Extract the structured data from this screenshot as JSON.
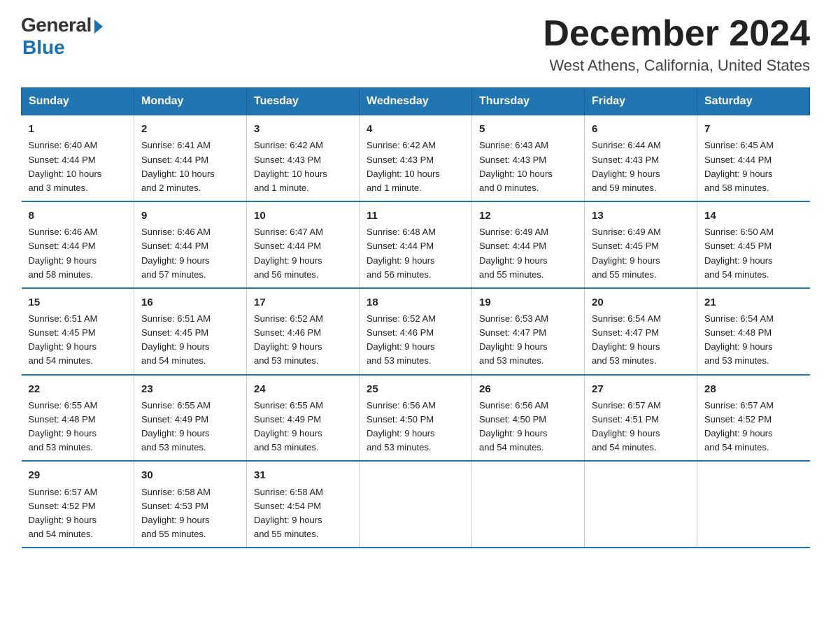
{
  "logo": {
    "general": "General",
    "blue": "Blue"
  },
  "title": "December 2024",
  "location": "West Athens, California, United States",
  "days_of_week": [
    "Sunday",
    "Monday",
    "Tuesday",
    "Wednesday",
    "Thursday",
    "Friday",
    "Saturday"
  ],
  "weeks": [
    [
      {
        "day": "1",
        "info": "Sunrise: 6:40 AM\nSunset: 4:44 PM\nDaylight: 10 hours\nand 3 minutes."
      },
      {
        "day": "2",
        "info": "Sunrise: 6:41 AM\nSunset: 4:44 PM\nDaylight: 10 hours\nand 2 minutes."
      },
      {
        "day": "3",
        "info": "Sunrise: 6:42 AM\nSunset: 4:43 PM\nDaylight: 10 hours\nand 1 minute."
      },
      {
        "day": "4",
        "info": "Sunrise: 6:42 AM\nSunset: 4:43 PM\nDaylight: 10 hours\nand 1 minute."
      },
      {
        "day": "5",
        "info": "Sunrise: 6:43 AM\nSunset: 4:43 PM\nDaylight: 10 hours\nand 0 minutes."
      },
      {
        "day": "6",
        "info": "Sunrise: 6:44 AM\nSunset: 4:43 PM\nDaylight: 9 hours\nand 59 minutes."
      },
      {
        "day": "7",
        "info": "Sunrise: 6:45 AM\nSunset: 4:44 PM\nDaylight: 9 hours\nand 58 minutes."
      }
    ],
    [
      {
        "day": "8",
        "info": "Sunrise: 6:46 AM\nSunset: 4:44 PM\nDaylight: 9 hours\nand 58 minutes."
      },
      {
        "day": "9",
        "info": "Sunrise: 6:46 AM\nSunset: 4:44 PM\nDaylight: 9 hours\nand 57 minutes."
      },
      {
        "day": "10",
        "info": "Sunrise: 6:47 AM\nSunset: 4:44 PM\nDaylight: 9 hours\nand 56 minutes."
      },
      {
        "day": "11",
        "info": "Sunrise: 6:48 AM\nSunset: 4:44 PM\nDaylight: 9 hours\nand 56 minutes."
      },
      {
        "day": "12",
        "info": "Sunrise: 6:49 AM\nSunset: 4:44 PM\nDaylight: 9 hours\nand 55 minutes."
      },
      {
        "day": "13",
        "info": "Sunrise: 6:49 AM\nSunset: 4:45 PM\nDaylight: 9 hours\nand 55 minutes."
      },
      {
        "day": "14",
        "info": "Sunrise: 6:50 AM\nSunset: 4:45 PM\nDaylight: 9 hours\nand 54 minutes."
      }
    ],
    [
      {
        "day": "15",
        "info": "Sunrise: 6:51 AM\nSunset: 4:45 PM\nDaylight: 9 hours\nand 54 minutes."
      },
      {
        "day": "16",
        "info": "Sunrise: 6:51 AM\nSunset: 4:45 PM\nDaylight: 9 hours\nand 54 minutes."
      },
      {
        "day": "17",
        "info": "Sunrise: 6:52 AM\nSunset: 4:46 PM\nDaylight: 9 hours\nand 53 minutes."
      },
      {
        "day": "18",
        "info": "Sunrise: 6:52 AM\nSunset: 4:46 PM\nDaylight: 9 hours\nand 53 minutes."
      },
      {
        "day": "19",
        "info": "Sunrise: 6:53 AM\nSunset: 4:47 PM\nDaylight: 9 hours\nand 53 minutes."
      },
      {
        "day": "20",
        "info": "Sunrise: 6:54 AM\nSunset: 4:47 PM\nDaylight: 9 hours\nand 53 minutes."
      },
      {
        "day": "21",
        "info": "Sunrise: 6:54 AM\nSunset: 4:48 PM\nDaylight: 9 hours\nand 53 minutes."
      }
    ],
    [
      {
        "day": "22",
        "info": "Sunrise: 6:55 AM\nSunset: 4:48 PM\nDaylight: 9 hours\nand 53 minutes."
      },
      {
        "day": "23",
        "info": "Sunrise: 6:55 AM\nSunset: 4:49 PM\nDaylight: 9 hours\nand 53 minutes."
      },
      {
        "day": "24",
        "info": "Sunrise: 6:55 AM\nSunset: 4:49 PM\nDaylight: 9 hours\nand 53 minutes."
      },
      {
        "day": "25",
        "info": "Sunrise: 6:56 AM\nSunset: 4:50 PM\nDaylight: 9 hours\nand 53 minutes."
      },
      {
        "day": "26",
        "info": "Sunrise: 6:56 AM\nSunset: 4:50 PM\nDaylight: 9 hours\nand 54 minutes."
      },
      {
        "day": "27",
        "info": "Sunrise: 6:57 AM\nSunset: 4:51 PM\nDaylight: 9 hours\nand 54 minutes."
      },
      {
        "day": "28",
        "info": "Sunrise: 6:57 AM\nSunset: 4:52 PM\nDaylight: 9 hours\nand 54 minutes."
      }
    ],
    [
      {
        "day": "29",
        "info": "Sunrise: 6:57 AM\nSunset: 4:52 PM\nDaylight: 9 hours\nand 54 minutes."
      },
      {
        "day": "30",
        "info": "Sunrise: 6:58 AM\nSunset: 4:53 PM\nDaylight: 9 hours\nand 55 minutes."
      },
      {
        "day": "31",
        "info": "Sunrise: 6:58 AM\nSunset: 4:54 PM\nDaylight: 9 hours\nand 55 minutes."
      },
      {
        "day": "",
        "info": ""
      },
      {
        "day": "",
        "info": ""
      },
      {
        "day": "",
        "info": ""
      },
      {
        "day": "",
        "info": ""
      }
    ]
  ]
}
